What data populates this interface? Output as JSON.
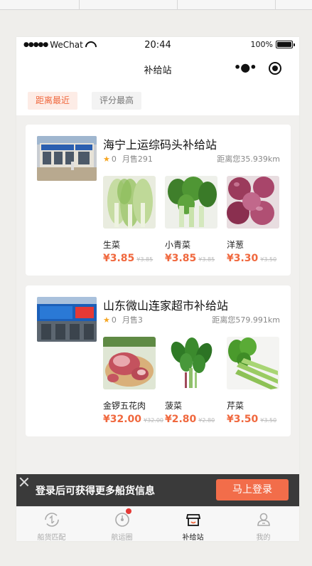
{
  "status_bar": {
    "carrier": "WeChat",
    "time": "20:44",
    "battery": "100%"
  },
  "nav": {
    "title": "补给站"
  },
  "filters": [
    {
      "label": "距离最近",
      "active": true
    },
    {
      "label": "评分最高",
      "active": false
    }
  ],
  "stores": [
    {
      "name": "海宁上运综码头补给站",
      "rating": "0",
      "sales": "月售291",
      "distance": "距离您35.939km",
      "products": [
        {
          "name": "生菜",
          "price": "¥3.85",
          "old_price": "¥3.85"
        },
        {
          "name": "小青菜",
          "price": "¥3.85",
          "old_price": "¥3.85"
        },
        {
          "name": "洋葱",
          "price": "¥3.30",
          "old_price": "¥3.50"
        }
      ]
    },
    {
      "name": "山东微山连家超市补给站",
      "rating": "0",
      "sales": "月售3",
      "distance": "距离您579.991km",
      "products": [
        {
          "name": "金锣五花肉",
          "price": "¥32.00",
          "old_price": "¥32.00"
        },
        {
          "name": "菠菜",
          "price": "¥2.80",
          "old_price": "¥2.80"
        },
        {
          "name": "芹菜",
          "price": "¥3.50",
          "old_price": "¥3.50"
        }
      ]
    }
  ],
  "login_banner": {
    "text": "登录后可获得更多船货信息",
    "button": "马上登录"
  },
  "tabs": [
    {
      "label": "船货匹配",
      "icon": "cargo-match-icon"
    },
    {
      "label": "航运圈",
      "icon": "shipping-circle-icon"
    },
    {
      "label": "补给站",
      "icon": "supply-station-icon",
      "active": true
    },
    {
      "label": "我的",
      "icon": "profile-icon"
    }
  ],
  "colors": {
    "accent": "#f0683e",
    "banner_bg": "#3a3a3a",
    "button": "#f26d4a"
  }
}
